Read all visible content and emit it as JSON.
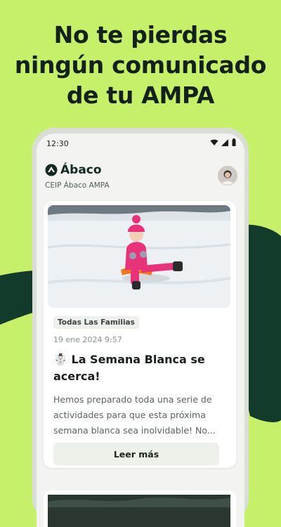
{
  "promo": {
    "headline_line1": "No te pierdas",
    "headline_line2": "ningún comunicado",
    "headline_line3": "de tu AMPA"
  },
  "colors": {
    "background": "#c6f06a",
    "brush": "#133b2c",
    "brand": "#0f2a22"
  },
  "status_bar": {
    "time": "12:30",
    "icons": [
      "wifi-icon",
      "signal-icon",
      "battery-icon"
    ]
  },
  "app": {
    "name": "Ábaco",
    "school": "CEIP Ábaco AMPA",
    "logo_icon": "abaco-logo-icon"
  },
  "post": {
    "tag": "Todas Las Familias",
    "date": "19 ene 2024 9:57",
    "title": "☃️ La Semana Blanca se acerca!",
    "excerpt": "Hemos preparado toda una serie de actividades para que esta próxima semana blanca sea inolvidable! No...",
    "read_more": "Leer más"
  }
}
